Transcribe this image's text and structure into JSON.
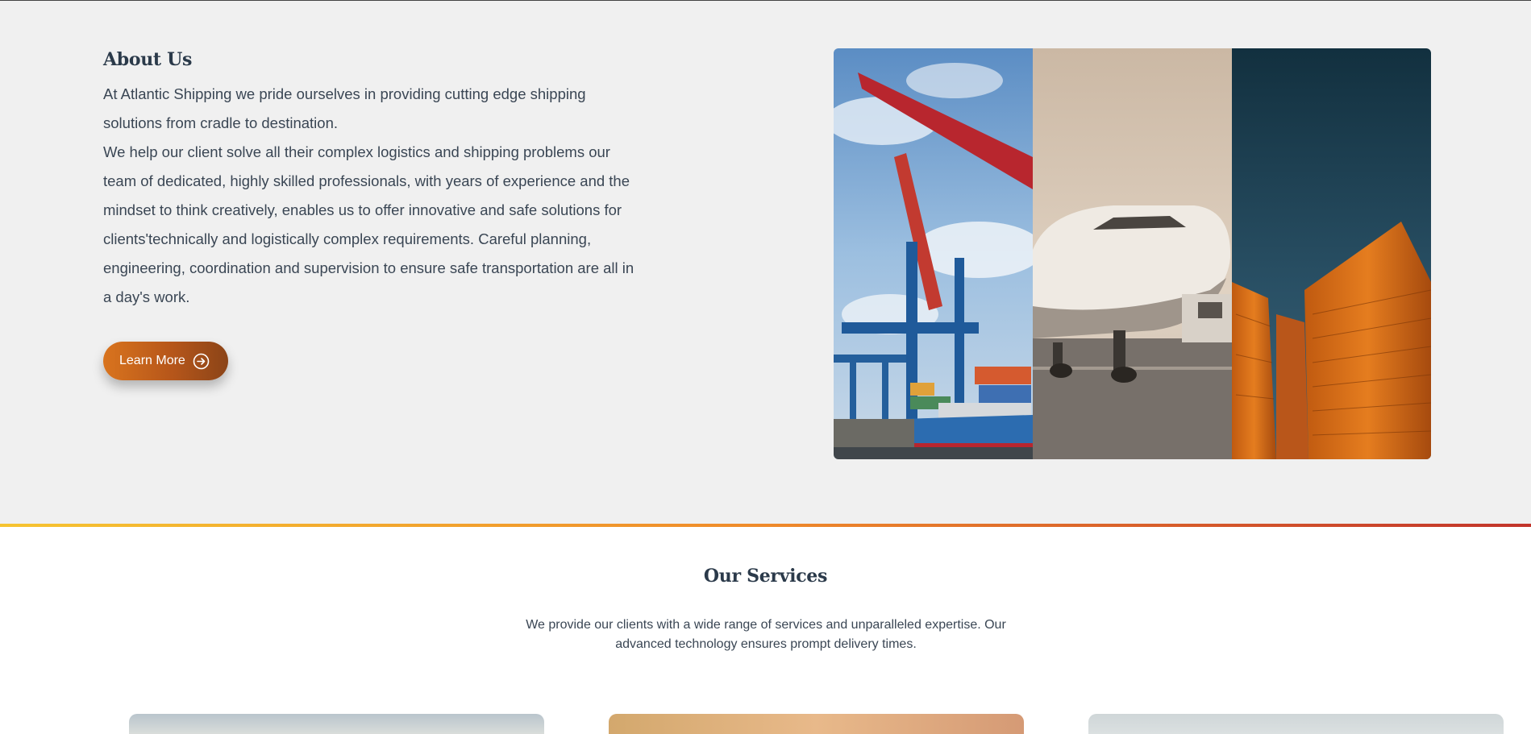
{
  "about": {
    "title": "About Us",
    "paragraph1": "At Atlantic Shipping we pride ourselves in providing cutting edge shipping solutions from cradle to destination.",
    "paragraph2": "We help our client solve all their complex logistics and shipping problems our team of dedicated, highly skilled professionals, with years of experience and the mindset to think creatively, enables us to offer innovative and safe solutions for clients'technically and logistically complex requirements. Careful planning, engineering, coordination and supervision to ensure safe transportation are all in a day's work.",
    "button_label": "Learn More",
    "button_icon": "arrow-circle-right-icon",
    "gallery": [
      "port-crane-photo",
      "airplane-photo",
      "shipping-containers-photo"
    ]
  },
  "services": {
    "title": "Our Services",
    "description": "We provide our clients with a wide range of services and unparalleled expertise. Our advanced technology ensures prompt delivery times."
  },
  "colors": {
    "accent_orange": "#d9741e",
    "heading": "#2b3a4a",
    "divider_start": "#f6c431",
    "divider_end": "#c2342b"
  }
}
